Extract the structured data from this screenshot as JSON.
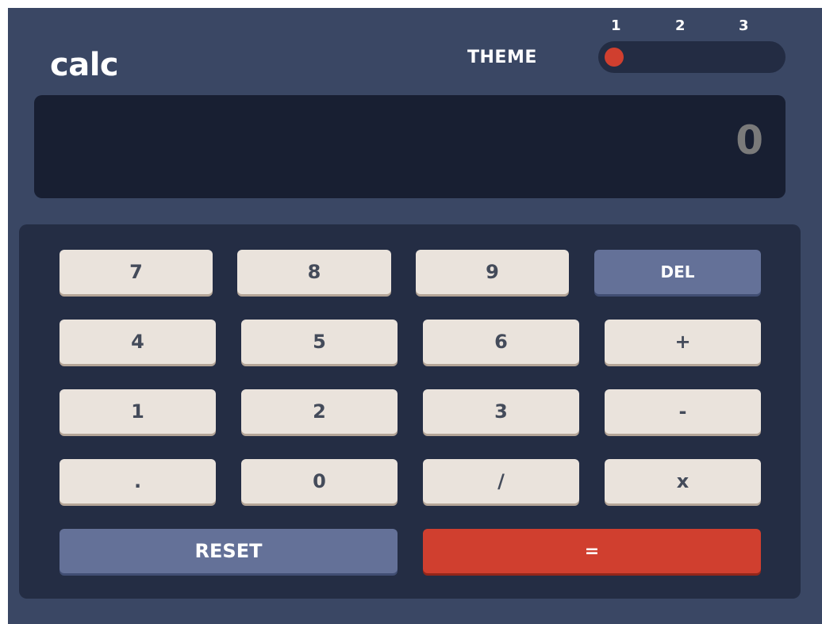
{
  "header": {
    "logo": "calc",
    "theme_label": "THEME",
    "theme_options": [
      "1",
      "2",
      "3"
    ],
    "theme_selected": 1
  },
  "display": {
    "value": "0"
  },
  "keys": {
    "row1": [
      "7",
      "8",
      "9",
      "DEL"
    ],
    "row2": [
      "4",
      "5",
      "6",
      "+"
    ],
    "row3": [
      "1",
      "2",
      "3",
      "-"
    ],
    "row4": [
      ".",
      "0",
      "/",
      "x"
    ],
    "reset": "RESET",
    "equals": "="
  },
  "colors": {
    "main_background": "#3a4764",
    "screen_background": "#181f32",
    "keypad_background": "#242d44",
    "key_background": "#eae3dc",
    "key_text": "#444b5a",
    "accent_blue": "#647198",
    "accent_red": "#d03f2f"
  }
}
